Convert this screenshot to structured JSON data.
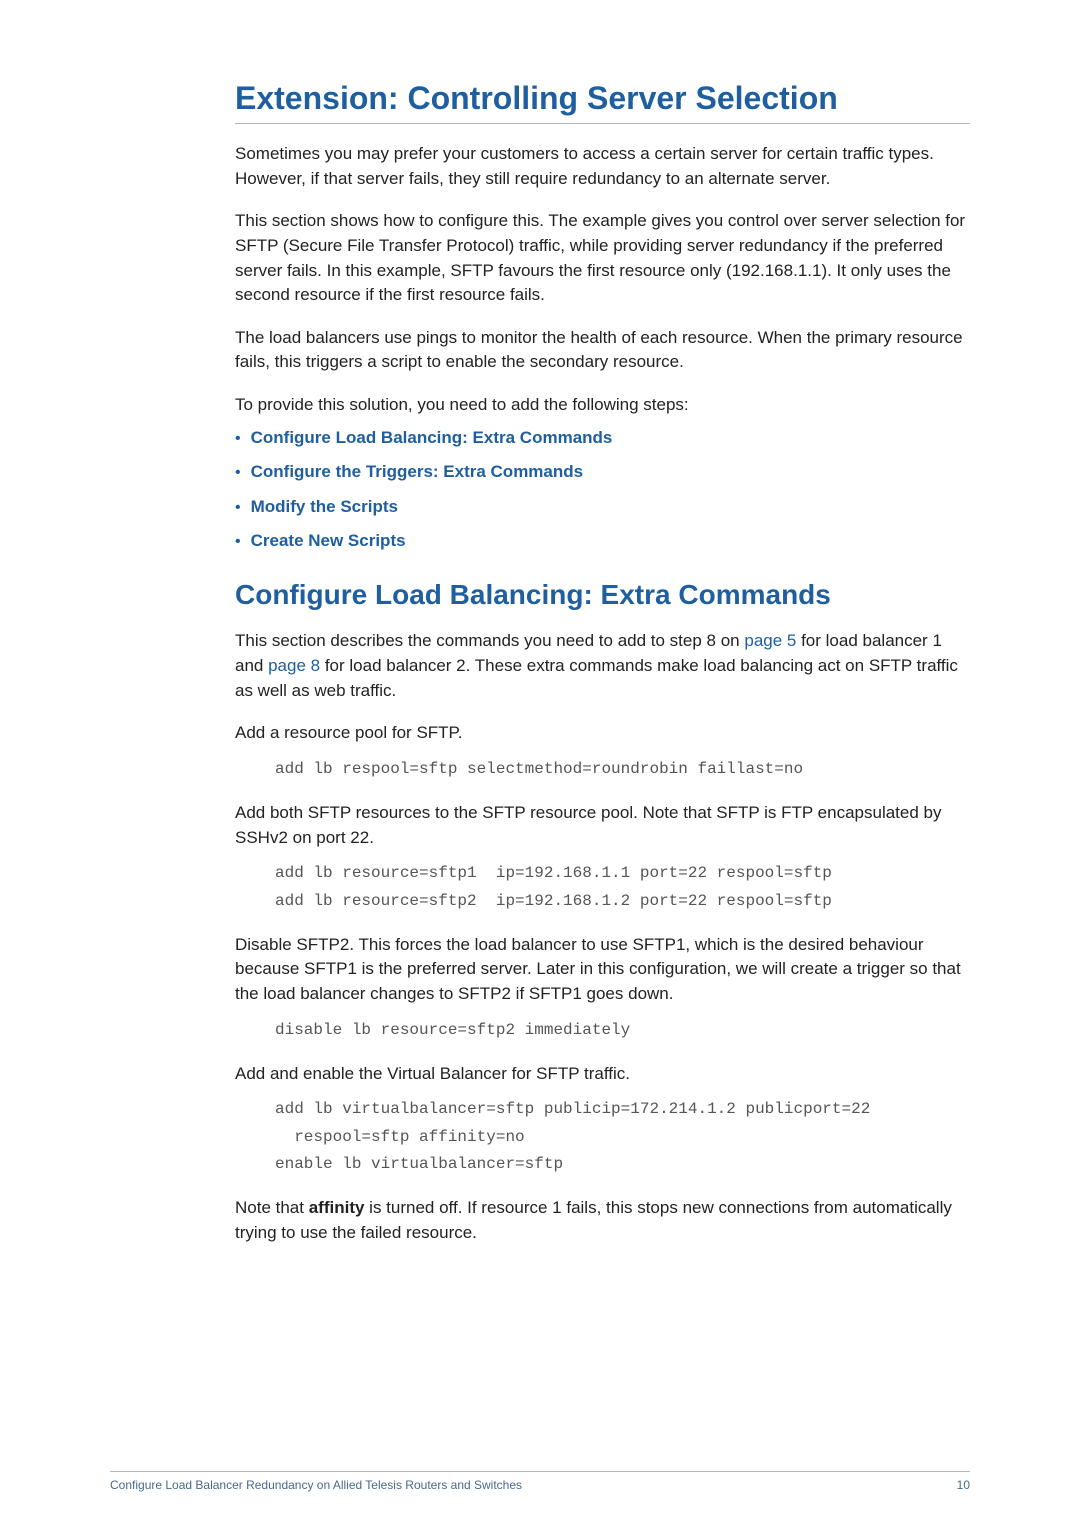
{
  "heading1": "Extension: Controlling Server Selection",
  "p1": "Sometimes you may prefer your customers to access a certain server for certain traffic types. However, if that server fails, they still require redundancy to an alternate server.",
  "p2": "This section shows how to configure this. The example gives you control over server selection for SFTP (Secure File Transfer Protocol) traffic, while providing server redundancy if the preferred server fails. In this example, SFTP favours the first resource only (192.168.1.1). It only uses the second resource if the first resource fails.",
  "p3": "The load balancers use pings to monitor the health of each resource. When the primary resource fails, this triggers a script to enable the secondary resource.",
  "p4": "To provide this solution, you need to add the following steps:",
  "steps": [
    "Configure Load Balancing: Extra Commands",
    "Configure the Triggers: Extra Commands",
    "Modify the Scripts",
    "Create New Scripts"
  ],
  "heading2": "Configure Load Balancing: Extra Commands",
  "p5a": "This section describes the commands you need to add to step 8 on ",
  "p5link1": "page 5",
  "p5b": " for load balancer 1 and ",
  "p5link2": "page 8",
  "p5c": " for load balancer 2. These extra commands make load balancing act on SFTP traffic as well as web traffic.",
  "p6": "Add a resource pool for SFTP.",
  "code1": "add lb respool=sftp selectmethod=roundrobin faillast=no",
  "p7": "Add both SFTP resources to the SFTP resource pool. Note that SFTP is FTP encapsulated by SSHv2 on port 22.",
  "code2": "add lb resource=sftp1  ip=192.168.1.1 port=22 respool=sftp\nadd lb resource=sftp2  ip=192.168.1.2 port=22 respool=sftp",
  "p8": "Disable SFTP2. This forces the load balancer to use SFTP1, which is the desired behaviour because SFTP1 is the preferred server. Later in this configuration, we will create a trigger so that the load balancer changes to SFTP2 if SFTP1 goes down.",
  "code3": "disable lb resource=sftp2 immediately",
  "p9": "Add and enable the Virtual Balancer for SFTP traffic.",
  "code4": "add lb virtualbalancer=sftp publicip=172.214.1.2 publicport=22\n  respool=sftp affinity=no\nenable lb virtualbalancer=sftp",
  "p10a": "Note that ",
  "p10bold": "affinity",
  "p10b": " is turned off. If resource 1 fails, this stops new connections from automatically trying to use the failed resource.",
  "footer": {
    "title": "Configure Load Balancer Redundancy on Allied Telesis Routers and Switches",
    "page": "10"
  }
}
